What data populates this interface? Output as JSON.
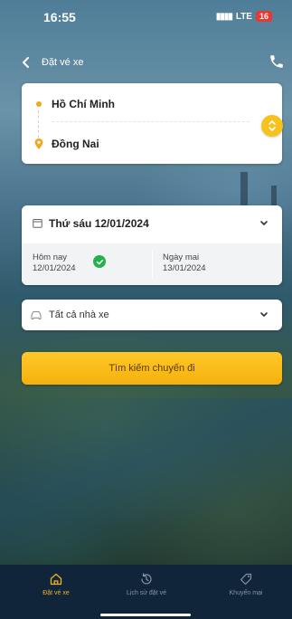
{
  "status_bar": {
    "time": "16:55",
    "network": "LTE",
    "battery": "16"
  },
  "nav": {
    "title": "Đặt vé xe",
    "back_icon": "chevron-left-icon",
    "phone_icon": "phone-icon"
  },
  "route": {
    "origin": "Hồ Chí Minh",
    "destination": "Đồng Nai",
    "swap_icon": "swap-vertical-icon"
  },
  "date": {
    "selected": "Thứ sáu 12/01/2024",
    "today_label": "Hôm nay",
    "today_date": "12/01/2024",
    "tomorrow_label": "Ngày mai",
    "tomorrow_date": "13/01/2024"
  },
  "operator": {
    "selected": "Tất cả nhà xe"
  },
  "search": {
    "button_label": "Tìm kiếm chuyến đi"
  },
  "tabs": [
    {
      "label": "Đặt vé xe",
      "icon": "home-icon",
      "active": true
    },
    {
      "label": "Lịch sử đặt vé",
      "icon": "history-icon",
      "active": false
    },
    {
      "label": "Khuyến mại",
      "icon": "tag-icon",
      "active": false
    }
  ],
  "colors": {
    "accent": "#f5b10e",
    "check": "#22b14c",
    "tab_bg": "#10243a"
  }
}
